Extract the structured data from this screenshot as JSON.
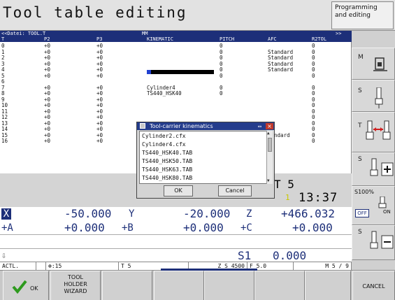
{
  "header": {
    "title": "Tool table editing",
    "mode": [
      "Programming",
      "and editing"
    ]
  },
  "table": {
    "file_label": "<<Datei: TOOL.T",
    "unit": "MM",
    "nav": ">>",
    "columns": [
      "T",
      "P2",
      "P3",
      "KINEMATIC",
      "PITCH",
      "AFC",
      "R2TOL"
    ],
    "rows": [
      [
        "0",
        "+0",
        "+0",
        "",
        "0",
        "",
        "0"
      ],
      [
        "1",
        "+0",
        "+0",
        "",
        "0",
        "Standard",
        "0"
      ],
      [
        "2",
        "+0",
        "+0",
        "",
        "0",
        "Standard",
        "0"
      ],
      [
        "3",
        "+0",
        "+0",
        "",
        "0",
        "Standard",
        "0"
      ],
      [
        "4",
        "+0",
        "+0",
        "",
        "0",
        "Standard",
        "0"
      ],
      [
        "5",
        "+0",
        "+0",
        "",
        "0",
        "",
        "0"
      ],
      [
        "6",
        "",
        "",
        "",
        "",
        "",
        ""
      ],
      [
        "7",
        "+0",
        "+0",
        "Cylinder4",
        "0",
        "",
        "0"
      ],
      [
        "8",
        "+0",
        "+0",
        "TS440_HSK40",
        "0",
        "",
        "0"
      ],
      [
        "9",
        "+0",
        "+0",
        "",
        "",
        "",
        "0"
      ],
      [
        "10",
        "+0",
        "+0",
        "",
        "",
        "",
        "0"
      ],
      [
        "11",
        "+0",
        "+0",
        "",
        "",
        "",
        "0"
      ],
      [
        "12",
        "+0",
        "+0",
        "",
        "",
        "",
        "0"
      ],
      [
        "13",
        "+0",
        "+0",
        "",
        "",
        "",
        "0"
      ],
      [
        "14",
        "+0",
        "+0",
        "",
        "",
        "",
        "0"
      ],
      [
        "15",
        "+0",
        "+0",
        "",
        "",
        "tandard",
        "0"
      ],
      [
        "16",
        "+0",
        "+0",
        "",
        "",
        "",
        "0"
      ]
    ]
  },
  "popup": {
    "title": "Tool-carrier kinematics",
    "items": [
      "Cylinder2.cfx",
      "Cylinder4.cfx",
      "TS440_HSK40.TAB",
      "TS440_HSK50.TAB",
      "TS440_HSK63.TAB",
      "TS440_HSK80.TAB"
    ],
    "ok": "OK",
    "cancel": "Cancel"
  },
  "status": {
    "tool": "T 5",
    "clock": "13:37",
    "indicator": "1"
  },
  "positions": {
    "x_label": "X",
    "x_value": "-50.000",
    "y_label": "Y",
    "y_value": "-20.000",
    "z_label": "Z",
    "z_value": "+466.032",
    "a_label": "+A",
    "a_value": "+0.000",
    "b_label": "+B",
    "b_value": "+0.000",
    "c_label": "+C",
    "c_value": "+0.000",
    "s_label": "S1",
    "s_value": "0.000"
  },
  "actual": {
    "mode": "ACTL.",
    "f_override": "15",
    "tool": "T 5",
    "spindle": "Z S 4500",
    "feed": "F 5.0",
    "m": "M 5 / 9"
  },
  "right_softkeys": {
    "m_label": "M",
    "s_label": "S",
    "t_label": "T",
    "s2_label": "S",
    "s100": "S100%",
    "off": "OFF",
    "on": "ON",
    "s3_label": "S"
  },
  "softkeys": {
    "ok": "OK",
    "wizard": [
      "TOOL",
      "HOLDER",
      "WIZARD"
    ],
    "cancel": "CANCEL"
  },
  "colors": {
    "accent": "#1d2f79",
    "title_bar": "#243c8c",
    "close_button": "#c0392b",
    "ok_check": "#2e9a1e"
  }
}
